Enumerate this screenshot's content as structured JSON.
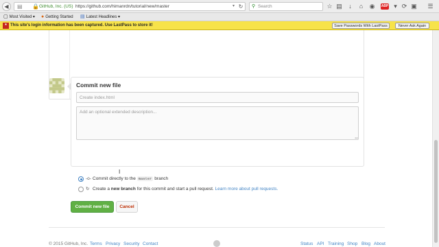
{
  "browser": {
    "identity": "GitHub, Inc. (US)",
    "url": "https://github.com/himanrdn/tutorial/new/master",
    "search_placeholder": "Search",
    "abp_label": "ABP"
  },
  "bookmarks": [
    {
      "label": "Most Visited",
      "icon": "bookmark-folder-icon"
    },
    {
      "label": "Getting Started",
      "icon": "firefox-icon"
    },
    {
      "label": "Latest Headlines",
      "icon": "rss-feed-icon"
    }
  ],
  "lastpass": {
    "message": "This site's login information has been captured. Use LastPass to store it!",
    "save_button": "Save Passwords With LastPass",
    "never_button": "Never Ask Again",
    "icon_text": "*"
  },
  "commit": {
    "title": "Commit new file",
    "summary_placeholder": "Create index.html",
    "description_placeholder": "Add an optional extended description...",
    "option_direct_prefix": "Commit directly to the",
    "branch_name": "master",
    "option_direct_suffix": "branch",
    "option_new_prefix": "Create a",
    "option_new_bold": "new branch",
    "option_new_suffix": "for this commit and start a pull request.",
    "option_new_link": "Learn more about pull requests.",
    "selected_option": "direct",
    "commit_button": "Commit new file",
    "cancel_button": "Cancel"
  },
  "footer": {
    "copyright": "© 2015 GitHub, Inc.",
    "left_links": [
      "Terms",
      "Privacy",
      "Security",
      "Contact"
    ],
    "right_links": [
      "Status",
      "API",
      "Training",
      "Shop",
      "Blog",
      "About"
    ]
  },
  "colors": {
    "commit_button": "#60b044",
    "cancel_text": "#bd2c00",
    "link": "#4183c4",
    "lastpass_bar": "#f7e34a"
  }
}
